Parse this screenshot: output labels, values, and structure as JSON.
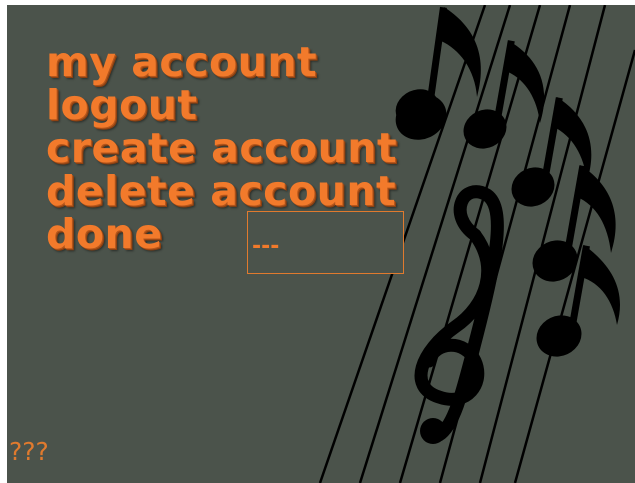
{
  "menu": {
    "items": [
      {
        "label": "my account"
      },
      {
        "label": "logout"
      },
      {
        "label": "create account"
      },
      {
        "label": "delete account"
      },
      {
        "label": "done"
      }
    ]
  },
  "input": {
    "value": "---"
  },
  "status": {
    "text": "???"
  },
  "colors": {
    "background": "#4b534b",
    "accent": "#f27a2b",
    "artwork": "#000000"
  },
  "icons": [
    "music-notes-icon",
    "treble-clef-icon"
  ]
}
